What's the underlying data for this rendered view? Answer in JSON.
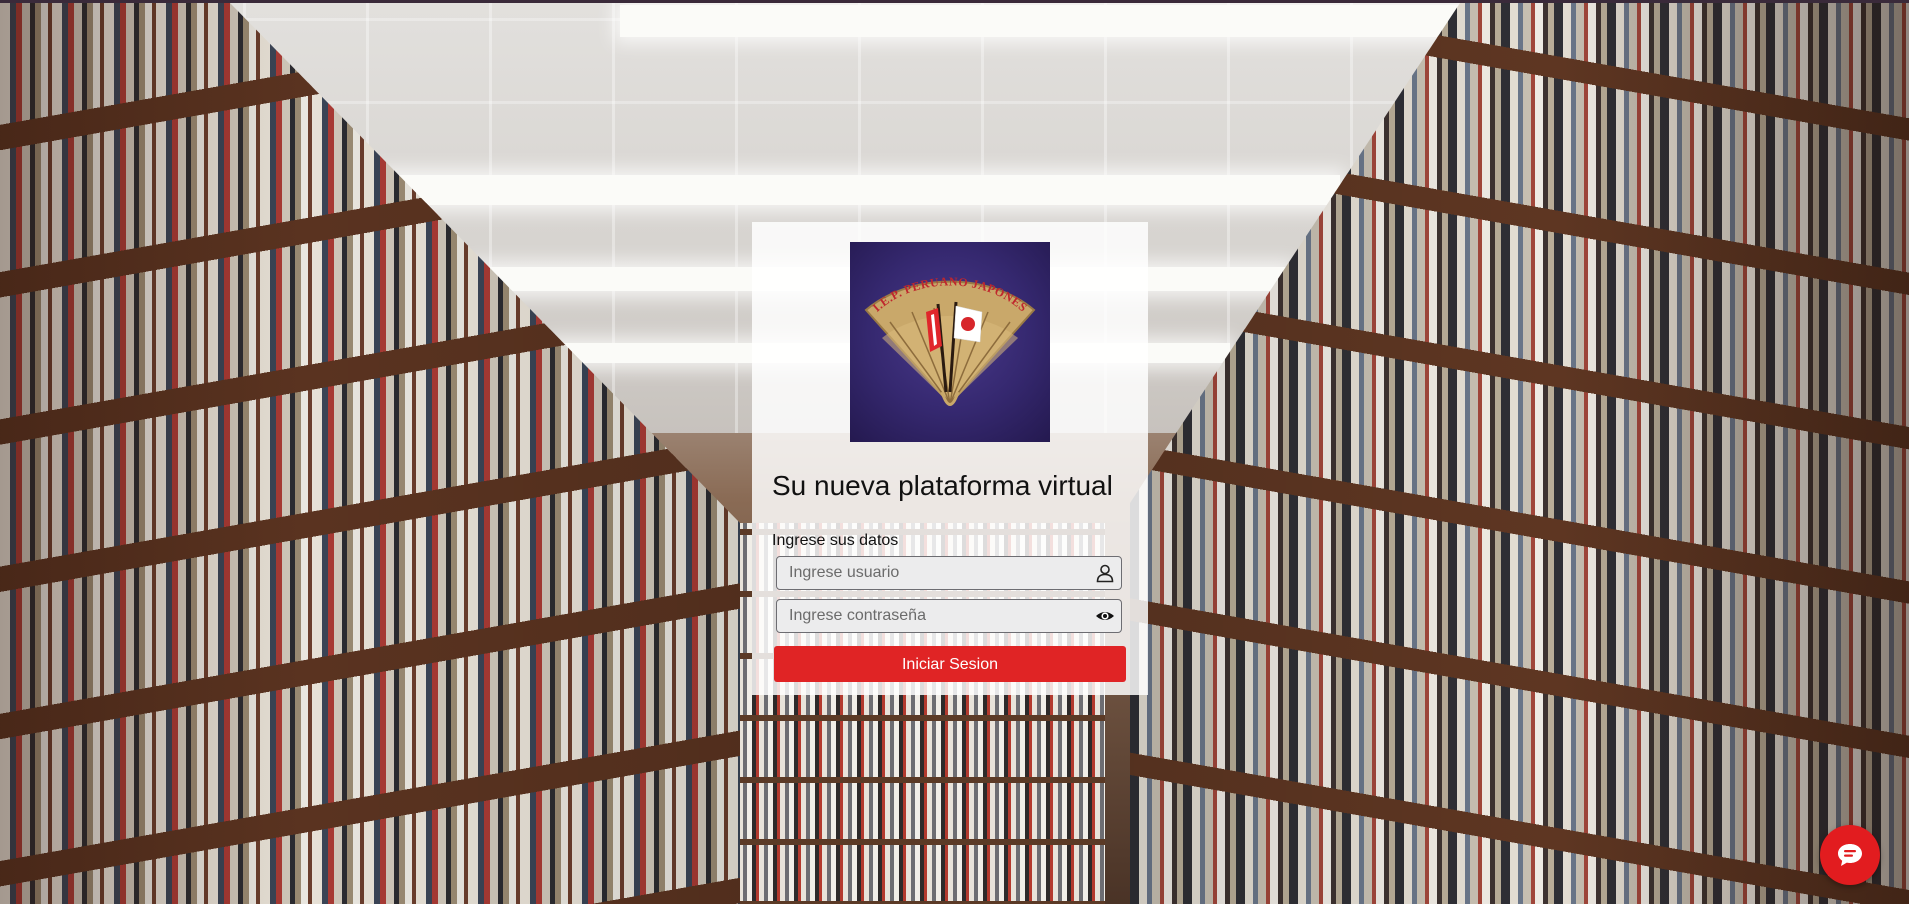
{
  "login": {
    "logo_text": "I.E.P. PERUANO JAPONES",
    "title": "Su nueva plataforma virtual",
    "form_label": "Ingrese sus datos",
    "username_placeholder": "Ingrese usuario",
    "password_placeholder": "Ingrese contraseña",
    "submit_label": "Iniciar Sesion",
    "icons": {
      "username": "user-icon",
      "password": "eye-icon"
    }
  },
  "chat": {
    "icon": "chat-bubble-icon"
  },
  "colors": {
    "primary_button": "#e02425",
    "logo_background": "#35286f",
    "logo_fan": "#c9a86a",
    "chat_button": "#e21c1f"
  }
}
